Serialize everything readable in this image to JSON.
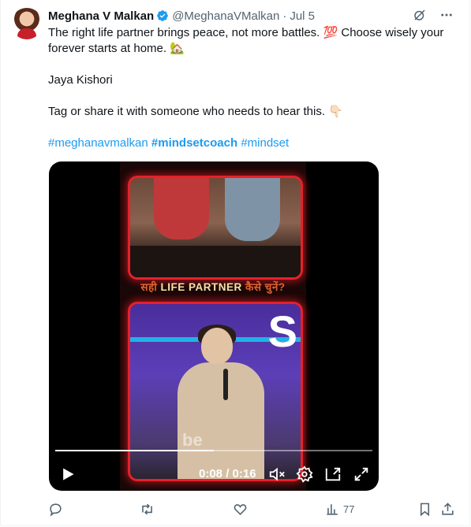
{
  "tweet": {
    "author_name": "Meghana V Malkan",
    "handle": "@MeghanaVMalkan",
    "separator": "·",
    "date": "Jul 5",
    "text_line1": "The right life partner brings peace, not more battles. 💯 Choose wisely your forever starts at home. 🏡",
    "text_line2": "Jaya Kishori",
    "text_line3": "Tag or share it with someone who needs to hear this. 👇🏻",
    "hashtags": [
      "#meghanavmalkan",
      "#mindsetcoach",
      "#mindset"
    ]
  },
  "video": {
    "caption_hi1": "सही",
    "caption_en": "LIFE PARTNER",
    "caption_hi2": "कैसे चुनें?",
    "watermark": "be",
    "time_display": "0:08 / 0:16",
    "progress_fraction": 0.5
  },
  "actions": {
    "views_count": "77"
  },
  "icons": {
    "top": [
      "grok-icon",
      "more-icon"
    ],
    "controls": [
      "play-icon",
      "mute-icon",
      "settings-icon",
      "pip-icon",
      "fullscreen-icon"
    ],
    "actions": [
      "reply-icon",
      "retweet-icon",
      "like-icon",
      "views-icon",
      "bookmark-icon",
      "share-icon"
    ]
  },
  "colors": {
    "link": "#1d9bf0",
    "muted": "#536471",
    "verified": "#1d9bf0",
    "neon": "#e6212a"
  }
}
